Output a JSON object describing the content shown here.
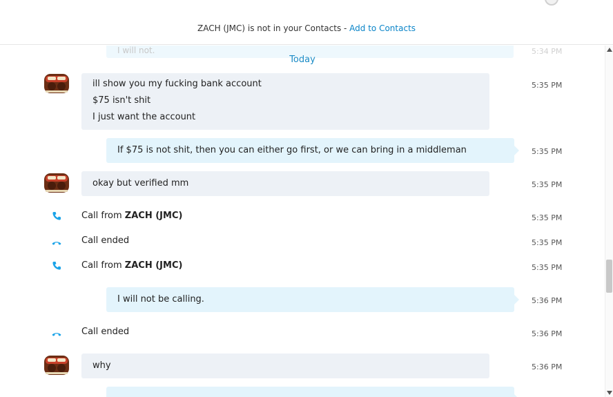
{
  "notice": {
    "text": "ZACH (JMC) is not in your Contacts - ",
    "link": "Add to Contacts"
  },
  "icons": {
    "globe": "globe-icon",
    "avatar": "user-avatar-icon",
    "incoming_call": "phone-incoming-icon",
    "call_ended": "phone-hangup-icon"
  },
  "colors": {
    "accent": "#0a84c8",
    "incoming_bubble": "#edf1f6",
    "outgoing_bubble": "#e3f4fc"
  },
  "chat": {
    "ghost_text": "I will not.",
    "ghost_time": "5:34 PM",
    "date_divider": "Today",
    "msg1": {
      "lines": [
        "ill show you my fucking bank account",
        "$75 isn't shit",
        "I just want the account"
      ],
      "time": "5:35 PM"
    },
    "msg2": {
      "text": "If $75 is not shit, then you can either go first, or we can bring in a middleman",
      "time": "5:35 PM"
    },
    "msg3": {
      "text": "okay but verified mm",
      "time": "5:35 PM"
    },
    "call1": {
      "prefix": "Call from ",
      "name": "ZACH (JMC)",
      "time": "5:35 PM"
    },
    "call2": {
      "text": "Call ended",
      "time": "5:35 PM"
    },
    "call3": {
      "prefix": "Call from ",
      "name": "ZACH (JMC)",
      "time": "5:35 PM"
    },
    "msg4": {
      "text": "I will not be calling.",
      "time": "5:36 PM"
    },
    "call4": {
      "text": "Call ended",
      "time": "5:36 PM"
    },
    "msg5": {
      "text": "why",
      "time": "5:36 PM"
    }
  }
}
